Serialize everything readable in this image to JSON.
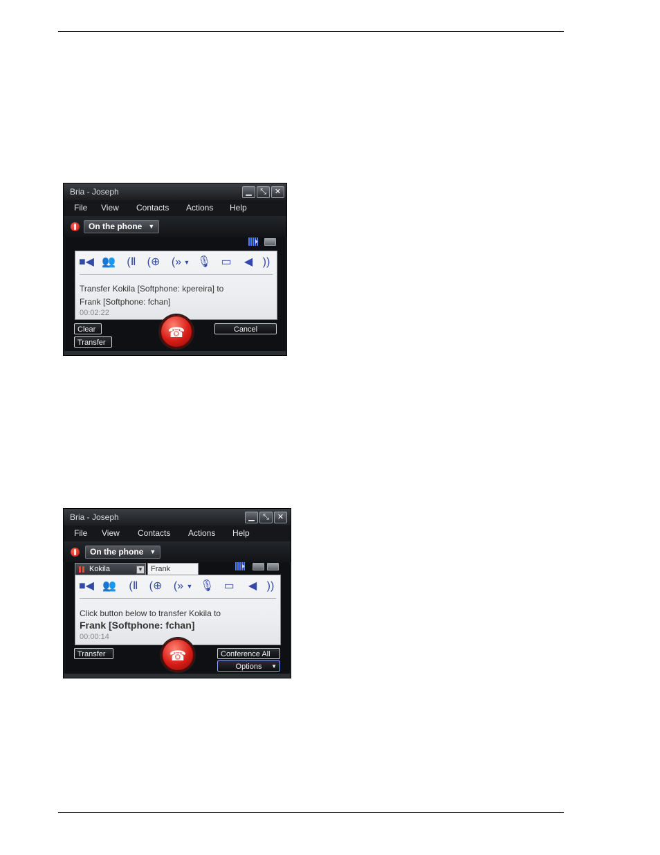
{
  "window1": {
    "title": "Bria - Joseph",
    "controls": {
      "minimize": "▁",
      "restore": "⤡",
      "close": "✕"
    },
    "menu": [
      "File",
      "View",
      "Contacts",
      "Actions",
      "Help"
    ],
    "status": "On the phone",
    "toolbar_icons": [
      "video-icon",
      "contacts-icon",
      "hold-icon",
      "add-call-icon",
      "transfer-icon",
      "dropdown-caret-icon",
      "microphone-icon",
      "record-icon",
      "speaker-icon",
      "volume-icon"
    ],
    "message_line1": "Transfer Kokila [Softphone: kpereira] to",
    "message_line2": "Frank [Softphone: fchan]",
    "timer": "00:02:22",
    "buttons": {
      "clear": "Clear",
      "cancel": "Cancel",
      "transfer": "Transfer"
    }
  },
  "window2": {
    "title": "Bria - Joseph",
    "controls": {
      "minimize": "▁",
      "restore": "⤡",
      "close": "✕"
    },
    "menu": [
      "File",
      "View",
      "Contacts",
      "Actions",
      "Help"
    ],
    "status": "On the phone",
    "tabs": [
      "Kokila",
      "Frank"
    ],
    "message_line1": "Click button below to transfer Kokila to",
    "message_line2": "Frank [Softphone: fchan]",
    "timer": "00:00:14",
    "buttons": {
      "transfer": "Transfer",
      "conference_all": "Conference All",
      "options": "Options"
    }
  },
  "colors": {
    "toolbar_icon": "#3349a7",
    "hangup": "#d71d16",
    "window_bg": "#0e1013"
  }
}
